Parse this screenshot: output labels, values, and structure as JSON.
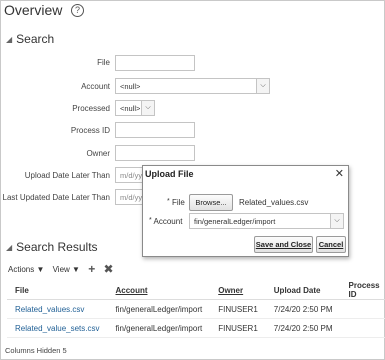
{
  "header": {
    "title": "Overview",
    "help_glyph": "?"
  },
  "search": {
    "title": "Search",
    "fields": {
      "file": {
        "label": "File",
        "value": ""
      },
      "account": {
        "label": "Account",
        "value": "<null>"
      },
      "processed": {
        "label": "Processed",
        "value": "<null>"
      },
      "process_id": {
        "label": "Process ID",
        "value": ""
      },
      "owner": {
        "label": "Owner",
        "value": ""
      },
      "upload_date": {
        "label": "Upload Date Later Than",
        "placeholder": "m/d/yy"
      },
      "last_updated": {
        "label": "Last Updated Date Later Than",
        "placeholder": "m/d/yy"
      }
    }
  },
  "dialog": {
    "title": "Upload File",
    "close_glyph": "✕",
    "file_label": "File",
    "browse_label": "Browse...",
    "file_name": "Related_values.csv",
    "account_label": "Account",
    "account_value": "fin/generalLedger/import",
    "save_close_label": "Save and Close",
    "cancel_label": "Cancel"
  },
  "results": {
    "title": "Search Results",
    "toolbar": {
      "actions_label": "Actions ▼",
      "view_label": "View ▼",
      "add_glyph": "+",
      "delete_glyph": "✖"
    },
    "columns": [
      "File",
      "Account",
      "Owner",
      "Upload Date",
      "Process ID"
    ],
    "rows": [
      {
        "file": "Related_values.csv",
        "account": "fin/generalLedger/import",
        "owner": "FINUSER1",
        "upload_date": "7/24/20 2:50 PM",
        "process_id": ""
      },
      {
        "file": "Related_value_sets.csv",
        "account": "fin/generalLedger/import",
        "owner": "FINUSER1",
        "upload_date": "7/24/20 2:50 PM",
        "process_id": ""
      }
    ],
    "columns_hidden_label": "Columns Hidden",
    "columns_hidden_count": "5"
  }
}
